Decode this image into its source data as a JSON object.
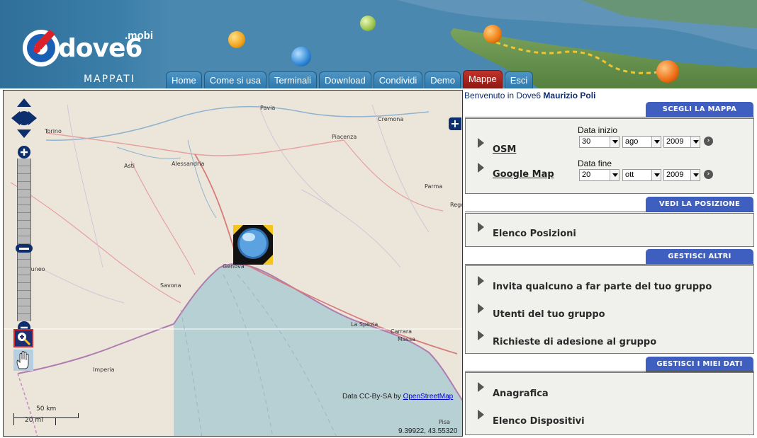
{
  "header": {
    "logo": "dove6",
    "logo_suffix": ".mobi",
    "subtitle": "MAPPATI"
  },
  "nav": [
    {
      "label": "Home",
      "active": false
    },
    {
      "label": "Come si usa",
      "active": false
    },
    {
      "label": "Terminali",
      "active": false
    },
    {
      "label": "Download",
      "active": false
    },
    {
      "label": "Condividi",
      "active": false
    },
    {
      "label": "Demo",
      "active": false
    },
    {
      "label": "Mappe",
      "active": true
    },
    {
      "label": "Esci",
      "active": false
    }
  ],
  "map": {
    "cities": [
      "Pavia",
      "Cremona",
      "Torino",
      "Piacenza",
      "Asti",
      "Alessandria",
      "Parma",
      "Rego",
      "Genova",
      "Cuneo",
      "Savona",
      "La Spezia",
      "Carrara",
      "Massa",
      "Imperia",
      "Pisa"
    ],
    "attribution_prefix": "Data CC-By-SA by",
    "attribution_link": "OpenStreetMap",
    "coordinates": "9.39922, 43.55320",
    "scale_km": "50 km",
    "scale_mi": "20 mi",
    "layer_switcher": "+"
  },
  "panel": {
    "welcome_prefix": "Benvenuto in Dove6",
    "user": "Maurizio Poli",
    "sections": {
      "map_choice": {
        "title": "SCEGLI LA MAPPA",
        "links": [
          "OSM",
          "Google Map"
        ],
        "start_label": "Data inizio",
        "start": {
          "day": "30",
          "month": "ago",
          "year": "2009"
        },
        "end_label": "Data fine",
        "end": {
          "day": "20",
          "month": "ott",
          "year": "2009"
        }
      },
      "position": {
        "title": "VEDI LA POSIZIONE",
        "items": [
          "Elenco Posizioni"
        ]
      },
      "users": {
        "title": "GESTISCI ALTRI UTENTI",
        "items": [
          "Invita qualcuno a far parte del tuo gruppo",
          "Utenti del tuo gruppo",
          "Richieste di adesione al gruppo"
        ]
      },
      "mydata": {
        "title": "GESTISCI I MIEI DATI",
        "items": [
          "Anagrafica",
          "Elenco Dispositivi"
        ]
      }
    }
  },
  "colors": {
    "nav_tab": "#2f78ad",
    "nav_active": "#b02820",
    "section_tab": "#3e5fbf",
    "map_land": "#ece6da",
    "map_sea": "#b7d0d4"
  }
}
